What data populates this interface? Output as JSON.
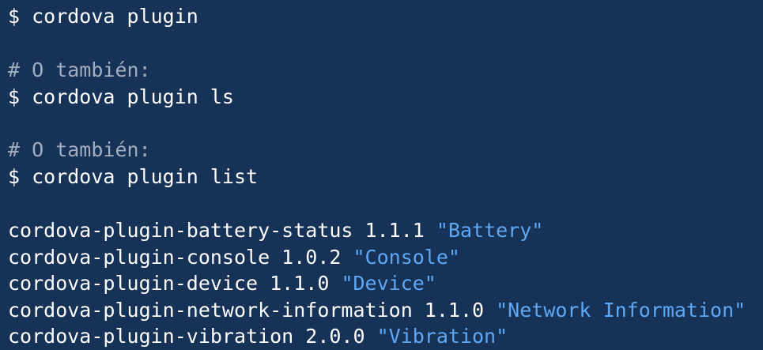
{
  "terminal": {
    "command_1": "$ cordova plugin",
    "comment_1": "# O también:",
    "command_2": "$ cordova plugin ls",
    "comment_2": "# O también:",
    "command_3": "$ cordova plugin list",
    "plugins": [
      {
        "text": "cordova-plugin-battery-status 1.1.1 ",
        "label": "\"Battery\""
      },
      {
        "text": "cordova-plugin-console 1.0.2 ",
        "label": "\"Console\""
      },
      {
        "text": "cordova-plugin-device 1.1.0 ",
        "label": "\"Device\""
      },
      {
        "text": "cordova-plugin-network-information 1.1.0 ",
        "label": "\"Network Information\""
      },
      {
        "text": "cordova-plugin-vibration 2.0.0 ",
        "label": "\"Vibration\""
      }
    ]
  },
  "colors": {
    "background": "#163257",
    "text": "#ffffff",
    "comment": "#a2aebf",
    "string": "#5fa8f5"
  }
}
